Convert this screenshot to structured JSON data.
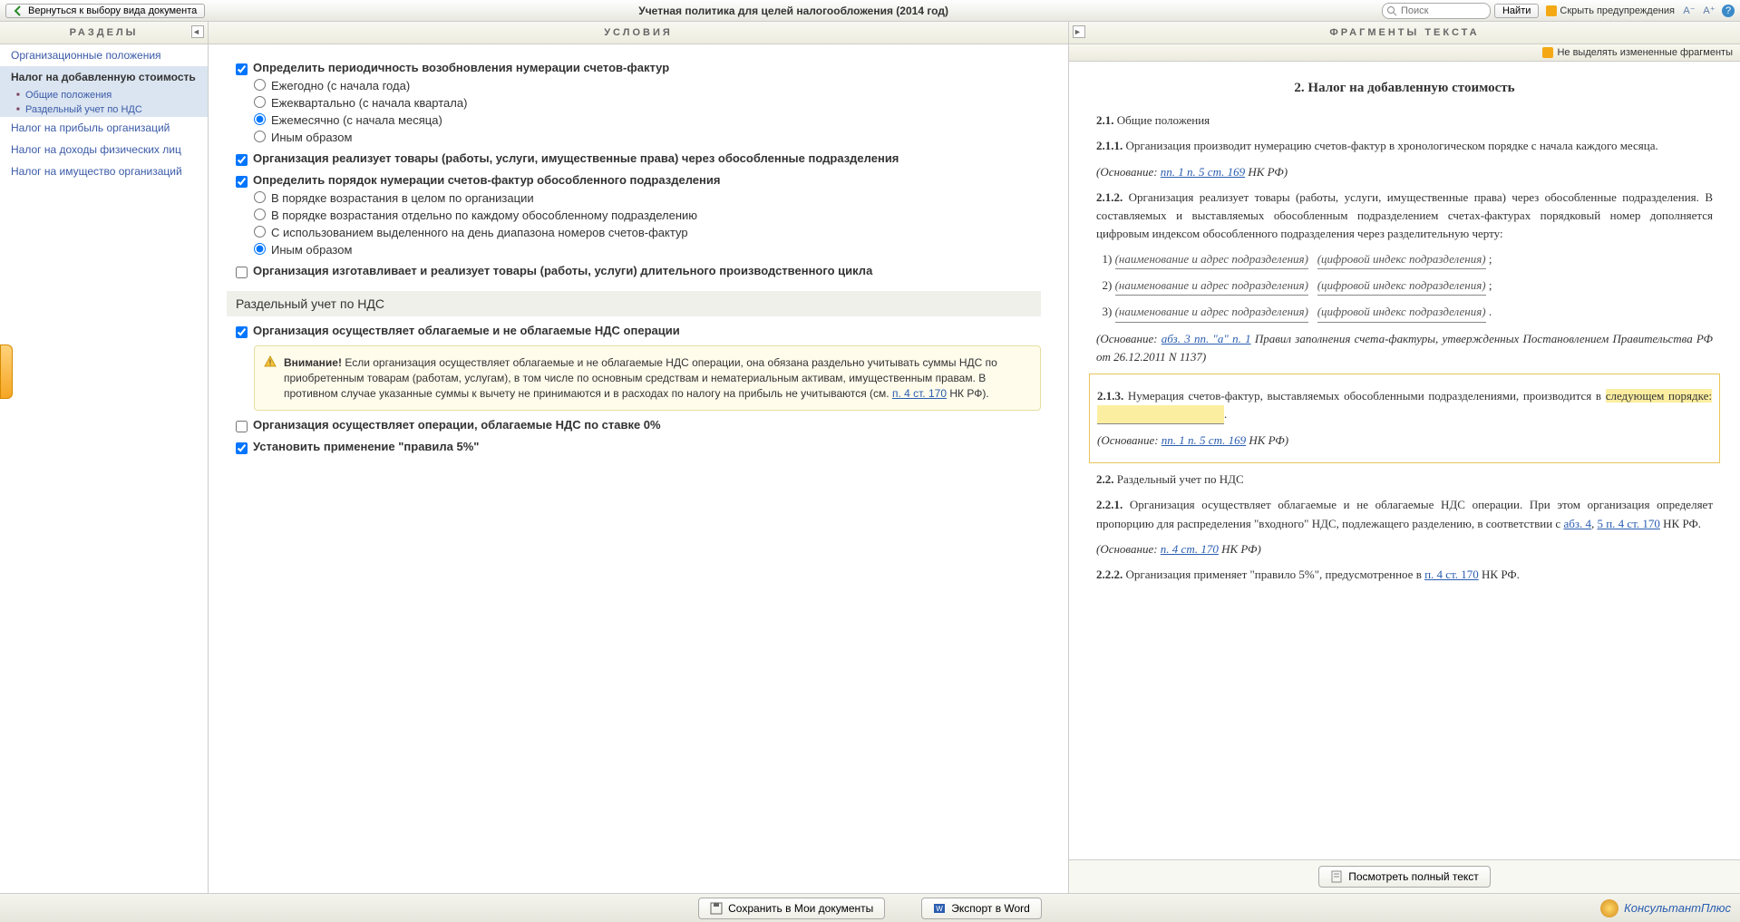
{
  "topbar": {
    "back": "Вернуться к выбору вида документа",
    "title": "Учетная политика для целей налогообложения (2014 год)",
    "search_placeholder": "Поиск",
    "find": "Найти",
    "hide_warnings": "Скрыть предупреждения"
  },
  "columns": {
    "sections": "РАЗДЕЛЫ",
    "conditions": "УСЛОВИЯ",
    "fragments": "ФРАГМЕНТЫ ТЕКСТА"
  },
  "sections": {
    "items": [
      "Организационные положения",
      "Налог на добавленную стоимость",
      "Налог на прибыль организаций",
      "Налог на доходы физических лиц",
      "Налог на имущество организаций"
    ],
    "subs": [
      "Общие положения",
      "Раздельный учет по НДС"
    ]
  },
  "conditions": {
    "c1": "Определить периодичность возобновления нумерации счетов-фактур",
    "r1": "Ежегодно (с начала года)",
    "r2": "Ежеквартально (с начала квартала)",
    "r3": "Ежемесячно (с начала месяца)",
    "r4": "Иным образом",
    "c2": "Организация реализует товары (работы, услуги, имущественные права) через обособленные подразделения",
    "c3": "Определить порядок нумерации счетов-фактур обособленного подразделения",
    "r5": "В порядке возрастания в целом по организации",
    "r6": "В порядке возрастания отдельно по каждому обособленному подразделению",
    "r7": "С использованием выделенного на день диапазона номеров счетов-фактур",
    "r8": "Иным образом",
    "c4": "Организация изготавливает и реализует товары (работы, услуги) длительного производственного цикла",
    "sub1": "Раздельный учет по НДС",
    "c5": "Организация осуществляет облагаемые и не облагаемые НДС операции",
    "warn_label": "Внимание!",
    "warn_text": " Если организация осуществляет облагаемые и не облагаемые НДС операции, она обязана раздельно учитывать суммы НДС по приобретенным товарам (работам, услугам), в том числе по основным средствам и нематериальным активам, имущественным правам. В противном случае указанные суммы к вычету не принимаются и в расходах по налогу на прибыль не учитываются (см. ",
    "warn_link": "п. 4 ст. 170",
    "warn_tail": " НК РФ).",
    "c6": "Организация осуществляет операции, облагаемые НДС по ставке 0%",
    "c7": "Установить применение \"правила 5%\""
  },
  "fragments": {
    "toolbar": "Не выделять измененные фрагменты",
    "h2": "2. Налог на добавленную стоимость",
    "s21": "2.1.",
    "s21t": " Общие положения",
    "s211": "2.1.1.",
    "s211t": " Организация производит нумерацию счетов-фактур в хронологическом порядке с начала каждого месяца.",
    "base": "(Основание: ",
    "link1": "пп. 1 п. 5 ст. 169",
    "nkrf": " НК РФ)",
    "s212": "2.1.2.",
    "s212t": " Организация реализует товары (работы, услуги, имущественные права) через обособленные подразделения. В составляемых и выставляемых обособленным подразделением счетах-фактурах порядковый номер дополняется цифровым индексом обособленного подразделения через разделительную черту:",
    "l1": "1)",
    "l2": "2)",
    "l3": "3)",
    "fill1": "(наименование и адрес подразделения)",
    "fill2": "(цифровой индекс подразделения)",
    "semi": ";",
    "dot": ".",
    "link2": "абз. 3 пп. \"а\" п. 1",
    "base2tail": " Правил заполнения счета-фактуры, утвержденных Постановлением Правительства РФ от 26.12.2011 N 1137)",
    "s213": "2.1.3.",
    "s213a": " Нумерация счетов-фактур, выставляемых обособленными подразделениями, производится в ",
    "s213hl": "следующем порядке: ",
    "s22": "2.2.",
    "s22t": " Раздельный учет по НДС",
    "s221": "2.2.1.",
    "s221t": " Организация осуществляет облагаемые и не облагаемые НДС операции. При этом организация определяет пропорцию для распределения \"входного\" НДС, подлежащего разделению, в соответствии с ",
    "link3": "абз. 4",
    "comma": ", ",
    "link4": "5 п. 4 ст. 170",
    "nkrf2": " НК РФ.",
    "link5": "п. 4 ст. 170",
    "s222": "2.2.2.",
    "s222t": " Организация применяет \"правило 5%\", предусмотренное в ",
    "full_text_btn": "Посмотреть полный текст"
  },
  "bottom": {
    "save": "Сохранить в Мои документы",
    "export": "Экспорт в Word",
    "brand": "КонсультантПлюс"
  }
}
